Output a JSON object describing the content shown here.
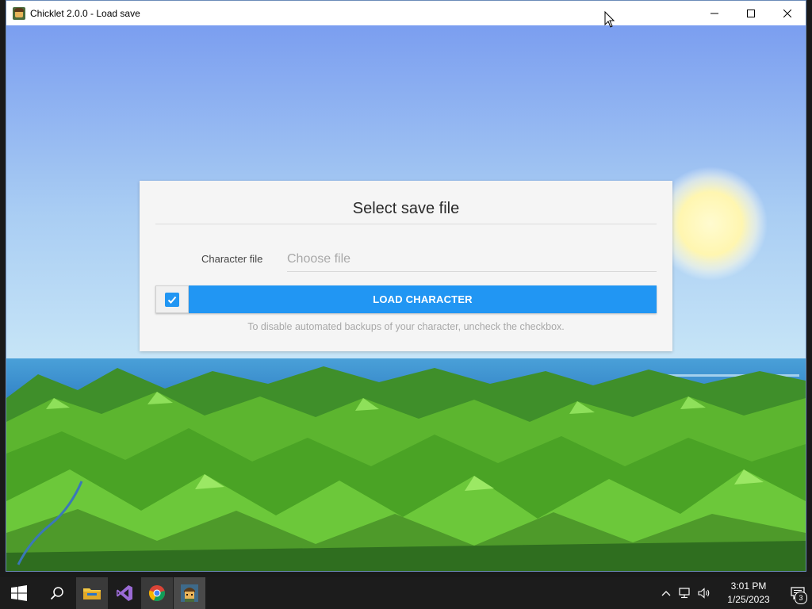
{
  "window": {
    "title": "Chicklet 2.0.0 - Load save",
    "controls": [
      "minimize-icon",
      "maximize-icon",
      "close-icon"
    ]
  },
  "dialog": {
    "title": "Select save file",
    "field_label": "Character file",
    "file_placeholder": "Choose file",
    "backup_checkbox_checked": true,
    "load_button_label": "LOAD CHARACTER",
    "hint": "To disable automated backups of your character, uncheck the checkbox."
  },
  "colors": {
    "accent": "#2196f3",
    "sky_top": "#7b9ef0",
    "sky_bottom": "#b8dcf5",
    "sea": "#3f8fcf",
    "mountain": "#4caf2a"
  },
  "taskbar": {
    "start_icon": "windows-start-icon",
    "search_icon": "search-icon",
    "apps": [
      {
        "name": "file-explorer",
        "icon": "folder-icon"
      },
      {
        "name": "visual-studio",
        "icon": "visual-studio-icon"
      },
      {
        "name": "chrome",
        "icon": "chrome-icon"
      },
      {
        "name": "chicklet",
        "icon": "chicklet-app-icon"
      }
    ],
    "tray_icons": [
      "chevron-up-icon",
      "network-icon",
      "volume-icon"
    ],
    "time": "3:01 PM",
    "date": "1/25/2023",
    "notification_count": "3"
  }
}
